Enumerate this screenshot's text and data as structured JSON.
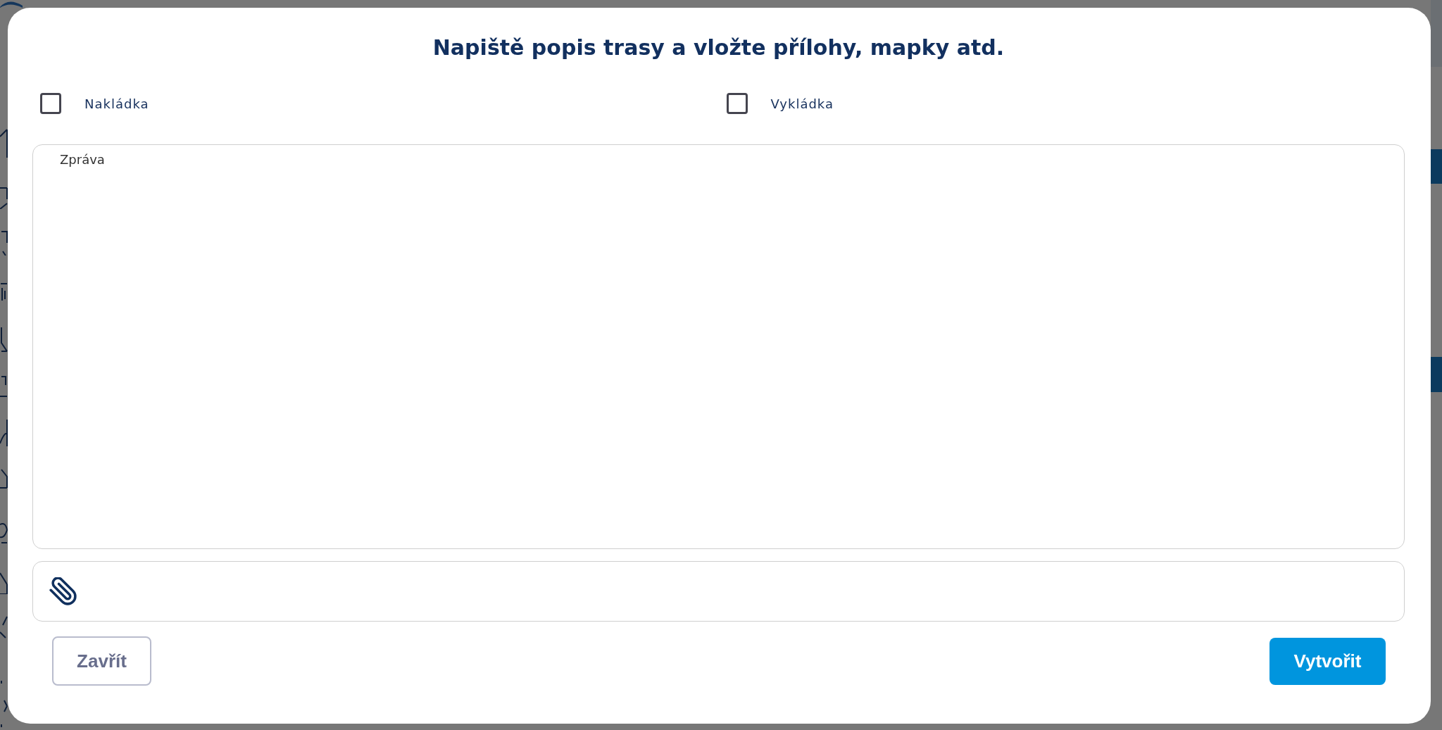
{
  "dialog": {
    "title": "Napiště popis trasy a vložte přílohy, mapky atd.",
    "options": [
      {
        "label": "Nakládka",
        "checked": false
      },
      {
        "label": "Vykládka",
        "checked": false
      }
    ],
    "message": {
      "placeholder": "Zpráva"
    },
    "buttons": [
      {
        "label": "Zavřít",
        "kind": "secondary"
      },
      {
        "label": "Vytvořit",
        "kind": "primary"
      }
    ]
  }
}
